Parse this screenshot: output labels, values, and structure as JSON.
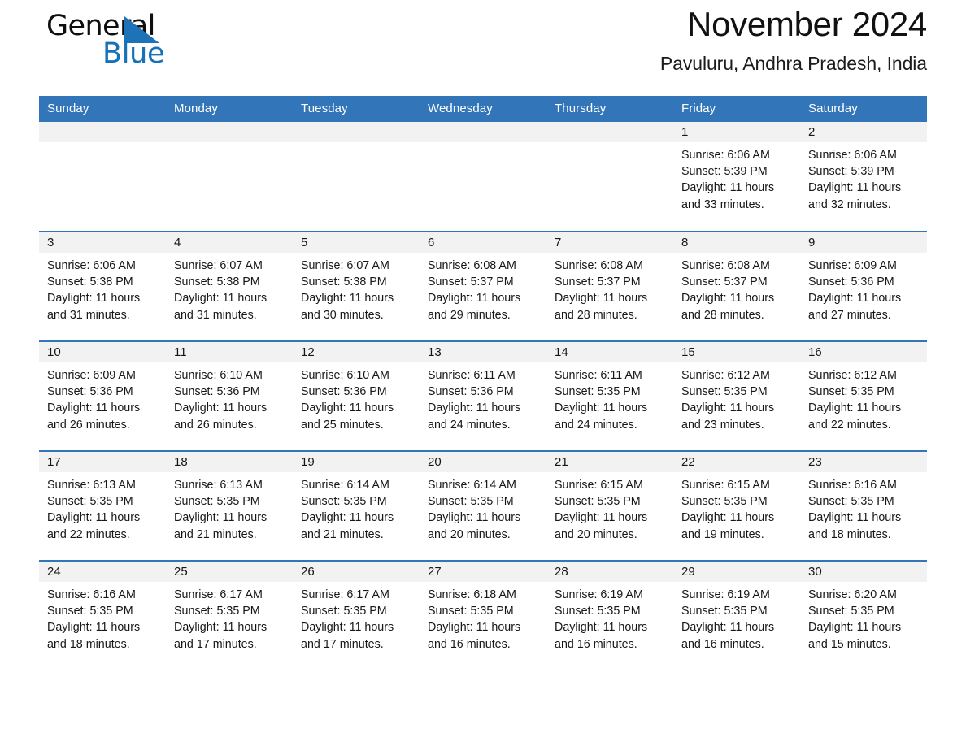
{
  "brand": {
    "line1": "General",
    "line2": "Blue",
    "triangle_color": "#1e72b8",
    "text_color": "#0f0f0f",
    "blue_text_color": "#1572b8"
  },
  "header": {
    "title": "November 2024",
    "subtitle": "Pavuluru, Andhra Pradesh, India"
  },
  "theme": {
    "header_blue": "#3275b8",
    "row_divider_blue": "#3275b8",
    "daynum_band_gray": "#f2f2f2",
    "page_background": "#ffffff"
  },
  "weekdays": [
    "Sunday",
    "Monday",
    "Tuesday",
    "Wednesday",
    "Thursday",
    "Friday",
    "Saturday"
  ],
  "labels": {
    "sunrise_prefix": "Sunrise:",
    "sunset_prefix": "Sunset:",
    "daylight_prefix": "Daylight:"
  },
  "weeks": [
    [
      {
        "day": "",
        "empty": true
      },
      {
        "day": "",
        "empty": true
      },
      {
        "day": "",
        "empty": true
      },
      {
        "day": "",
        "empty": true
      },
      {
        "day": "",
        "empty": true
      },
      {
        "day": "1",
        "sunrise": "Sunrise: 6:06 AM",
        "sunset": "Sunset: 5:39 PM",
        "daylight_l1": "Daylight: 11 hours",
        "daylight_l2": "and 33 minutes."
      },
      {
        "day": "2",
        "sunrise": "Sunrise: 6:06 AM",
        "sunset": "Sunset: 5:39 PM",
        "daylight_l1": "Daylight: 11 hours",
        "daylight_l2": "and 32 minutes."
      }
    ],
    [
      {
        "day": "3",
        "sunrise": "Sunrise: 6:06 AM",
        "sunset": "Sunset: 5:38 PM",
        "daylight_l1": "Daylight: 11 hours",
        "daylight_l2": "and 31 minutes."
      },
      {
        "day": "4",
        "sunrise": "Sunrise: 6:07 AM",
        "sunset": "Sunset: 5:38 PM",
        "daylight_l1": "Daylight: 11 hours",
        "daylight_l2": "and 31 minutes."
      },
      {
        "day": "5",
        "sunrise": "Sunrise: 6:07 AM",
        "sunset": "Sunset: 5:38 PM",
        "daylight_l1": "Daylight: 11 hours",
        "daylight_l2": "and 30 minutes."
      },
      {
        "day": "6",
        "sunrise": "Sunrise: 6:08 AM",
        "sunset": "Sunset: 5:37 PM",
        "daylight_l1": "Daylight: 11 hours",
        "daylight_l2": "and 29 minutes."
      },
      {
        "day": "7",
        "sunrise": "Sunrise: 6:08 AM",
        "sunset": "Sunset: 5:37 PM",
        "daylight_l1": "Daylight: 11 hours",
        "daylight_l2": "and 28 minutes."
      },
      {
        "day": "8",
        "sunrise": "Sunrise: 6:08 AM",
        "sunset": "Sunset: 5:37 PM",
        "daylight_l1": "Daylight: 11 hours",
        "daylight_l2": "and 28 minutes."
      },
      {
        "day": "9",
        "sunrise": "Sunrise: 6:09 AM",
        "sunset": "Sunset: 5:36 PM",
        "daylight_l1": "Daylight: 11 hours",
        "daylight_l2": "and 27 minutes."
      }
    ],
    [
      {
        "day": "10",
        "sunrise": "Sunrise: 6:09 AM",
        "sunset": "Sunset: 5:36 PM",
        "daylight_l1": "Daylight: 11 hours",
        "daylight_l2": "and 26 minutes."
      },
      {
        "day": "11",
        "sunrise": "Sunrise: 6:10 AM",
        "sunset": "Sunset: 5:36 PM",
        "daylight_l1": "Daylight: 11 hours",
        "daylight_l2": "and 26 minutes."
      },
      {
        "day": "12",
        "sunrise": "Sunrise: 6:10 AM",
        "sunset": "Sunset: 5:36 PM",
        "daylight_l1": "Daylight: 11 hours",
        "daylight_l2": "and 25 minutes."
      },
      {
        "day": "13",
        "sunrise": "Sunrise: 6:11 AM",
        "sunset": "Sunset: 5:36 PM",
        "daylight_l1": "Daylight: 11 hours",
        "daylight_l2": "and 24 minutes."
      },
      {
        "day": "14",
        "sunrise": "Sunrise: 6:11 AM",
        "sunset": "Sunset: 5:35 PM",
        "daylight_l1": "Daylight: 11 hours",
        "daylight_l2": "and 24 minutes."
      },
      {
        "day": "15",
        "sunrise": "Sunrise: 6:12 AM",
        "sunset": "Sunset: 5:35 PM",
        "daylight_l1": "Daylight: 11 hours",
        "daylight_l2": "and 23 minutes."
      },
      {
        "day": "16",
        "sunrise": "Sunrise: 6:12 AM",
        "sunset": "Sunset: 5:35 PM",
        "daylight_l1": "Daylight: 11 hours",
        "daylight_l2": "and 22 minutes."
      }
    ],
    [
      {
        "day": "17",
        "sunrise": "Sunrise: 6:13 AM",
        "sunset": "Sunset: 5:35 PM",
        "daylight_l1": "Daylight: 11 hours",
        "daylight_l2": "and 22 minutes."
      },
      {
        "day": "18",
        "sunrise": "Sunrise: 6:13 AM",
        "sunset": "Sunset: 5:35 PM",
        "daylight_l1": "Daylight: 11 hours",
        "daylight_l2": "and 21 minutes."
      },
      {
        "day": "19",
        "sunrise": "Sunrise: 6:14 AM",
        "sunset": "Sunset: 5:35 PM",
        "daylight_l1": "Daylight: 11 hours",
        "daylight_l2": "and 21 minutes."
      },
      {
        "day": "20",
        "sunrise": "Sunrise: 6:14 AM",
        "sunset": "Sunset: 5:35 PM",
        "daylight_l1": "Daylight: 11 hours",
        "daylight_l2": "and 20 minutes."
      },
      {
        "day": "21",
        "sunrise": "Sunrise: 6:15 AM",
        "sunset": "Sunset: 5:35 PM",
        "daylight_l1": "Daylight: 11 hours",
        "daylight_l2": "and 20 minutes."
      },
      {
        "day": "22",
        "sunrise": "Sunrise: 6:15 AM",
        "sunset": "Sunset: 5:35 PM",
        "daylight_l1": "Daylight: 11 hours",
        "daylight_l2": "and 19 minutes."
      },
      {
        "day": "23",
        "sunrise": "Sunrise: 6:16 AM",
        "sunset": "Sunset: 5:35 PM",
        "daylight_l1": "Daylight: 11 hours",
        "daylight_l2": "and 18 minutes."
      }
    ],
    [
      {
        "day": "24",
        "sunrise": "Sunrise: 6:16 AM",
        "sunset": "Sunset: 5:35 PM",
        "daylight_l1": "Daylight: 11 hours",
        "daylight_l2": "and 18 minutes."
      },
      {
        "day": "25",
        "sunrise": "Sunrise: 6:17 AM",
        "sunset": "Sunset: 5:35 PM",
        "daylight_l1": "Daylight: 11 hours",
        "daylight_l2": "and 17 minutes."
      },
      {
        "day": "26",
        "sunrise": "Sunrise: 6:17 AM",
        "sunset": "Sunset: 5:35 PM",
        "daylight_l1": "Daylight: 11 hours",
        "daylight_l2": "and 17 minutes."
      },
      {
        "day": "27",
        "sunrise": "Sunrise: 6:18 AM",
        "sunset": "Sunset: 5:35 PM",
        "daylight_l1": "Daylight: 11 hours",
        "daylight_l2": "and 16 minutes."
      },
      {
        "day": "28",
        "sunrise": "Sunrise: 6:19 AM",
        "sunset": "Sunset: 5:35 PM",
        "daylight_l1": "Daylight: 11 hours",
        "daylight_l2": "and 16 minutes."
      },
      {
        "day": "29",
        "sunrise": "Sunrise: 6:19 AM",
        "sunset": "Sunset: 5:35 PM",
        "daylight_l1": "Daylight: 11 hours",
        "daylight_l2": "and 16 minutes."
      },
      {
        "day": "30",
        "sunrise": "Sunrise: 6:20 AM",
        "sunset": "Sunset: 5:35 PM",
        "daylight_l1": "Daylight: 11 hours",
        "daylight_l2": "and 15 minutes."
      }
    ]
  ]
}
